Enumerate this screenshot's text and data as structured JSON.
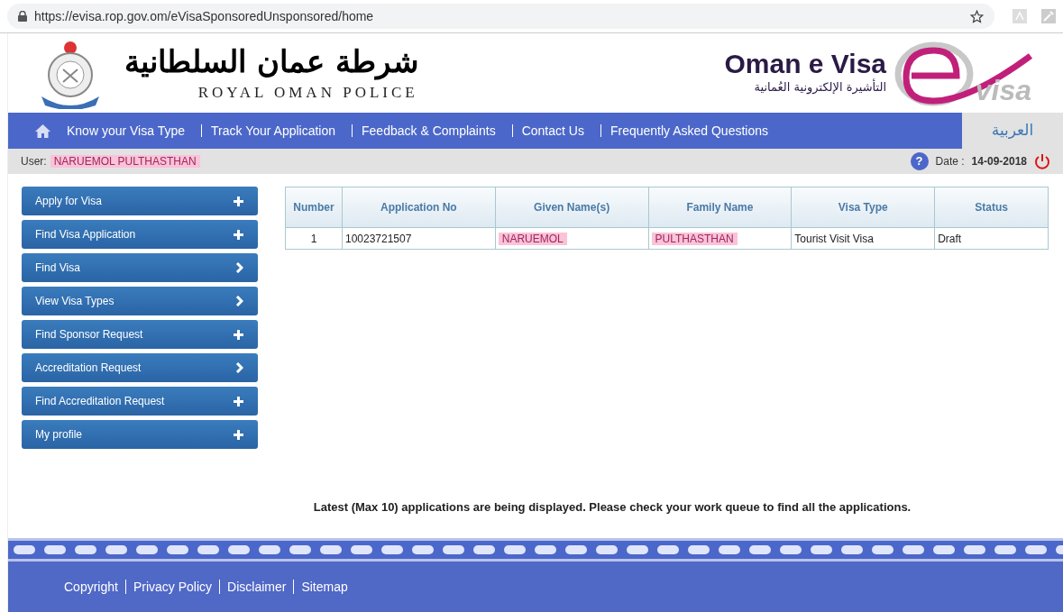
{
  "browser": {
    "url": "https://evisa.rop.gov.om/eVisaSponsoredUnsponsored/home"
  },
  "header": {
    "police_arabic": "شرطة عمان السلطانية",
    "police_english": "ROYAL OMAN POLICE",
    "evisa_title": "Oman e Visa",
    "evisa_arabic": "التأشيرة الإلكترونية العُمانية",
    "logo_word": "visa"
  },
  "nav": {
    "items": [
      "Know your Visa Type",
      "Track Your Application",
      "Feedback & Complaints",
      "Contact Us",
      "Frequently Asked Questions"
    ],
    "language": "العربية"
  },
  "user_bar": {
    "user_label": "User:",
    "user_name": "NARUEMOL PULTHASTHAN",
    "user_redacted": true,
    "help_glyph": "?",
    "date_label": "Date :",
    "date": "14-09-2018"
  },
  "sidebar": {
    "items": [
      {
        "label": "Apply for Visa",
        "kind": "plus"
      },
      {
        "label": "Find Visa Application",
        "kind": "plus"
      },
      {
        "label": "Find Visa",
        "kind": "chevron"
      },
      {
        "label": "View Visa Types",
        "kind": "chevron"
      },
      {
        "label": "Find Sponsor Request",
        "kind": "plus"
      },
      {
        "label": "Accreditation Request",
        "kind": "chevron"
      },
      {
        "label": "Find Accreditation Request",
        "kind": "plus"
      },
      {
        "label": "My profile",
        "kind": "plus"
      }
    ]
  },
  "table": {
    "columns": [
      "Number",
      "Application No",
      "Given Name(s)",
      "Family Name",
      "Visa Type",
      "Status"
    ],
    "rows": [
      {
        "cells": [
          {
            "text": "1",
            "redacted": false
          },
          {
            "text": "10023721507",
            "redacted": false
          },
          {
            "text": "NARUEMOL",
            "redacted": true
          },
          {
            "text": "PULTHASTHAN",
            "redacted": true
          },
          {
            "text": "Tourist Visit Visa",
            "redacted": false
          },
          {
            "text": "Draft",
            "redacted": false
          }
        ]
      }
    ]
  },
  "notice": "Latest (Max 10) applications are being displayed. Please check your work queue to find all the applications.",
  "footer": {
    "links": [
      "Copyright",
      "Privacy Policy",
      "Disclaimer",
      "Sitemap"
    ]
  }
}
